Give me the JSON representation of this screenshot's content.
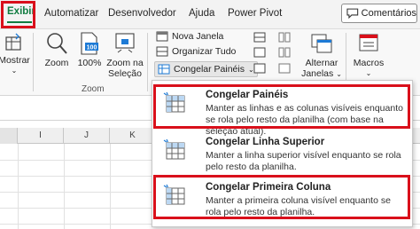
{
  "tabs": {
    "exibir": "Exibir",
    "automatizar": "Automatizar",
    "desenvolvedor": "Desenvolvedor",
    "ajuda": "Ajuda",
    "power_pivot": "Power Pivot"
  },
  "comments_button": "Comentários",
  "ribbon": {
    "mostrar": "Mostrar",
    "zoom": "Zoom",
    "zoom100": "100%",
    "zoom_selecao_l1": "Zoom na",
    "zoom_selecao_l2": "Seleção",
    "zoom_group": "Zoom",
    "nova_janela": "Nova Janela",
    "organizar_tudo": "Organizar Tudo",
    "congelar_paineis": "Congelar Painéis",
    "alternar_l1": "Alternar",
    "alternar_l2": "Janelas",
    "macros": "Macros"
  },
  "columns": [
    "I",
    "J",
    "K"
  ],
  "menu": {
    "items": [
      {
        "title": "Congelar Painéis",
        "desc": "Manter as linhas e as colunas visíveis enquanto se rola pelo resto da planilha (com base na seleção atual)."
      },
      {
        "title": "Congelar Linha Superior",
        "desc": "Manter a linha superior visível enquanto se rola pelo resto da planilha."
      },
      {
        "title": "Congelar Primeira Coluna",
        "desc": "Manter a primeira coluna visível enquanto se rola pelo resto da planilha."
      }
    ]
  },
  "colors": {
    "excel_green": "#107c41",
    "highlight_red": "#d9101b",
    "icon_blue": "#1e7bd6"
  }
}
